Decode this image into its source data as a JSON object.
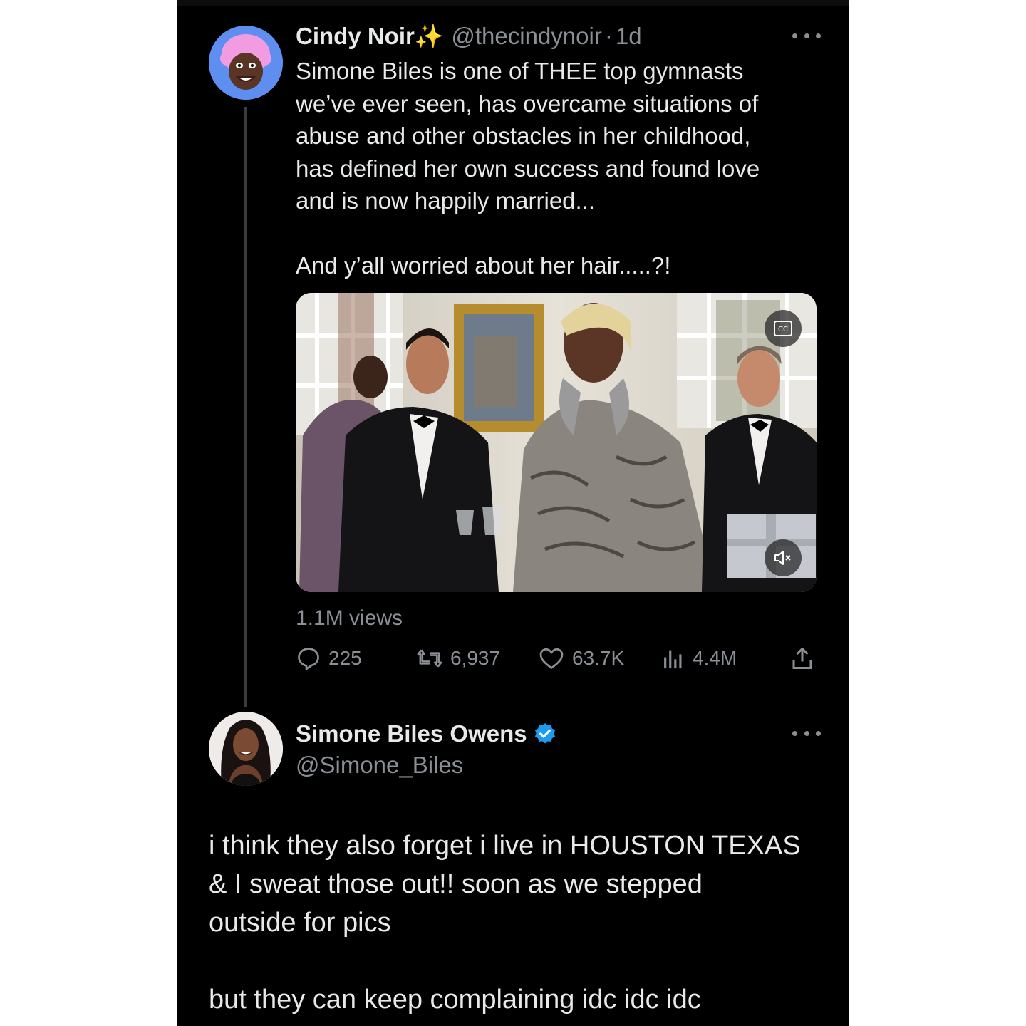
{
  "tweet1": {
    "author_name": "Cindy Noir",
    "name_emoji": "✨",
    "handle": "@thecindynoir",
    "separator": "·",
    "time": "1d",
    "text": "Simone Biles is one of THEE top gymnasts\nwe’ve ever seen, has overcame situations of\nabuse and other obstacles in her childhood,\nhas defined her own success and found love\nand is now happily married...\n\nAnd y’all worried about her hair.....?!",
    "views": "1.1M views",
    "replies": "225",
    "reposts": "6,937",
    "likes": "63.7K",
    "impressions": "4.4M"
  },
  "tweet2": {
    "author_name": "Simone Biles Owens",
    "handle": "@Simone_Biles",
    "text": "i think they also forget i live in HOUSTON TEXAS\n& I sweat those out!! soon as we stepped\noutside for pics\n\nbut they can keep complaining idc idc idc"
  },
  "colors": {
    "background": "#000000",
    "text": "#e7e9ea",
    "secondary": "#8b9096",
    "verified": "#1d9bf0",
    "avatar_bg": "#5e8ff0"
  },
  "icons": [
    "avatar-cartoon",
    "sparkles-icon",
    "more-icon",
    "captions-icon",
    "mute-icon",
    "reply-icon",
    "repost-icon",
    "like-icon",
    "analytics-icon",
    "share-icon",
    "verified-badge-icon"
  ]
}
